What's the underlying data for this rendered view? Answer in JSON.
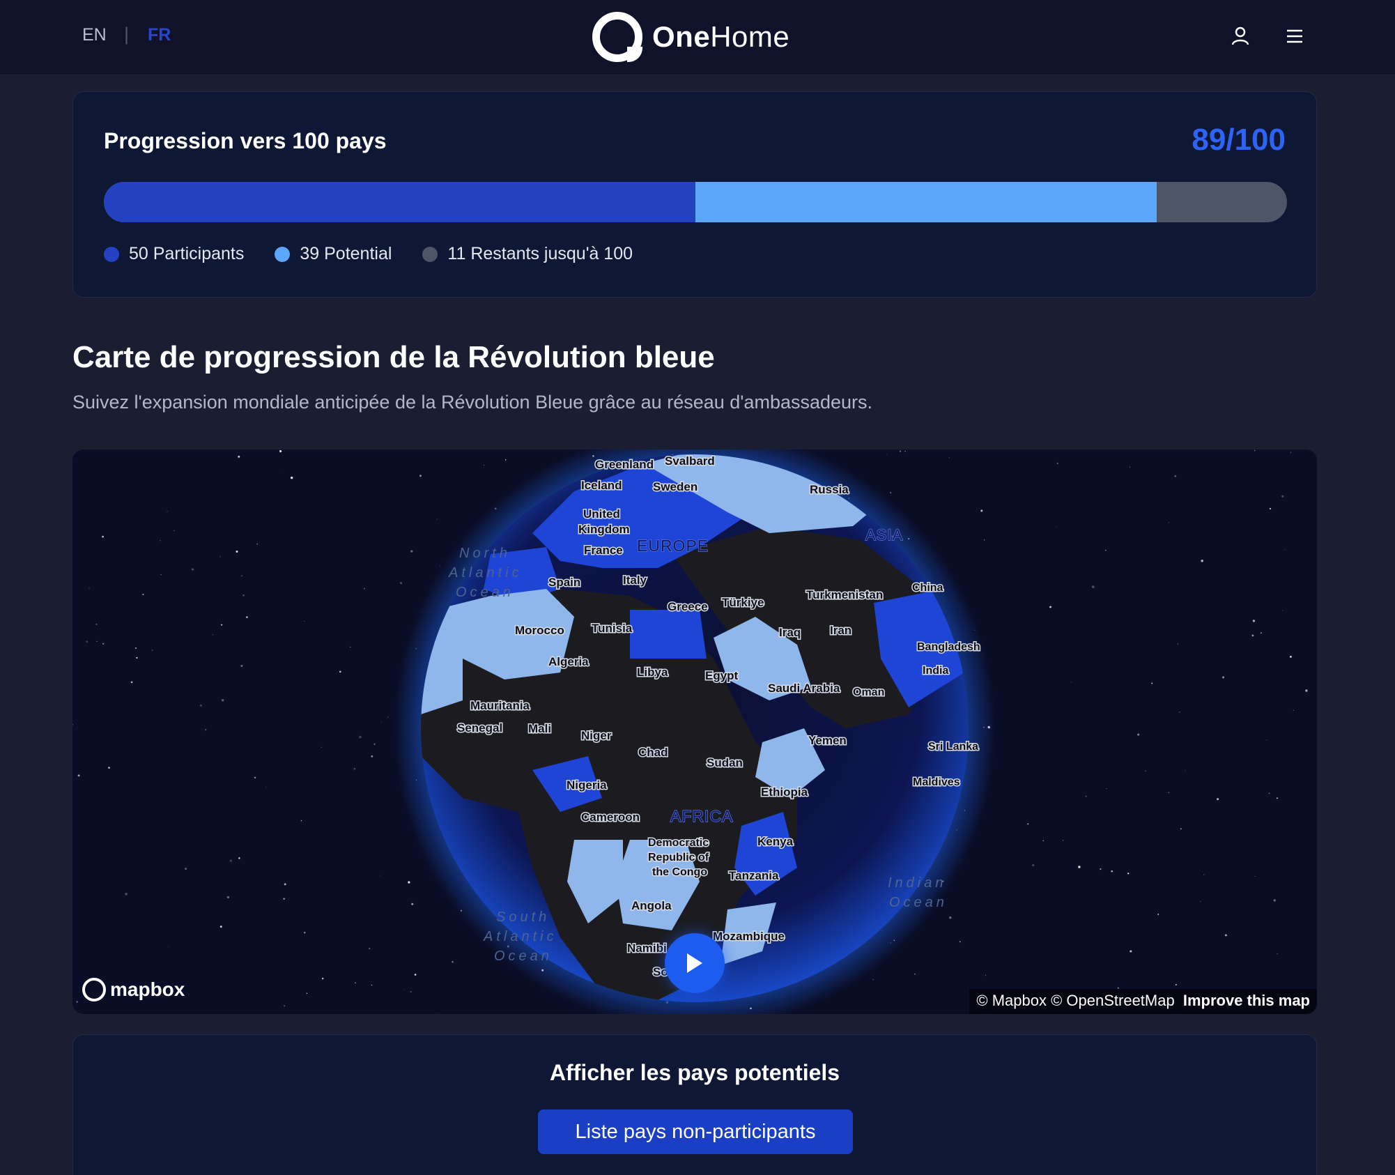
{
  "header": {
    "lang_en": "EN",
    "lang_separator": "|",
    "lang_fr": "FR",
    "brand_bold": "One",
    "brand_rest": "Home",
    "user_icon": "user-icon",
    "menu_icon": "hamburger-menu-icon"
  },
  "progress": {
    "title": "Progression vers 100 pays",
    "count": "89/100",
    "participants": 50,
    "potential": 39,
    "remaining": 11,
    "total": 100,
    "legend": [
      {
        "label": "50 Participants",
        "color": "#2441c2"
      },
      {
        "label": "39 Potential",
        "color": "#5ca6fb"
      },
      {
        "label": "11 Restants jusqu'à 100",
        "color": "#4d5566"
      }
    ]
  },
  "section": {
    "title": "Carte de progression de la Révolution bleue",
    "subtitle": "Suivez l'expansion mondiale anticipée de la Révolution Bleue grâce au réseau d'ambassadeurs."
  },
  "map": {
    "labels": {
      "greenland": "Greenland",
      "svalbard": "Svalbard",
      "iceland": "Iceland",
      "sweden": "Sweden",
      "russia": "Russia",
      "uk1": "United",
      "uk2": "Kingdom",
      "europe": "EUROPE",
      "asia": "ASIA",
      "france": "France",
      "spain": "Spain",
      "italy": "Italy",
      "greece": "Greece",
      "turkiye": "Türkiye",
      "turkmenistan": "Turkmenistan",
      "china": "China",
      "iraq": "Iraq",
      "iran": "Iran",
      "morocco": "Morocco",
      "tunisia": "Tunisia",
      "algeria": "Algeria",
      "libya": "Libya",
      "egypt": "Egypt",
      "bangladesh": "Bangladesh",
      "india": "India",
      "saudi": "Saudi Arabia",
      "oman": "Oman",
      "mauritania": "Mauritania",
      "senegal": "Senegal",
      "mali": "Mali",
      "niger": "Niger",
      "chad": "Chad",
      "sudan": "Sudan",
      "yemen": "Yemen",
      "srilanka": "Sri Lanka",
      "maldives": "Maldives",
      "nigeria": "Nigeria",
      "ethiopia": "Ethiopia",
      "cameroon": "Cameroon",
      "africa": "AFRICA",
      "drc1": "Democratic",
      "drc2": "Republic of",
      "drc3": "the Congo",
      "kenya": "Kenya",
      "tanzania": "Tanzania",
      "angola": "Angola",
      "mozambique": "Mozambique",
      "namibia": "Namibi",
      "so": "So",
      "na_ocean1": "North",
      "na_ocean2": "Atlantic",
      "na_ocean3": "Ocean",
      "sa_ocean1": "South",
      "sa_ocean2": "Atlantic",
      "sa_ocean3": "Ocean",
      "in_ocean1": "Indian",
      "in_ocean2": "Ocean"
    },
    "mapbox_wordmark": "mapbox",
    "attribution": "© Mapbox © OpenStreetMap",
    "improve": "Improve this map",
    "play_icon": "play-icon",
    "colors": {
      "participant": "#1f45d6",
      "potential": "#8fb7ec",
      "other": "#1c1c20",
      "glow": "#1f6bff"
    }
  },
  "bottom": {
    "title": "Afficher les pays potentiels",
    "button": "Liste pays non-participants"
  }
}
